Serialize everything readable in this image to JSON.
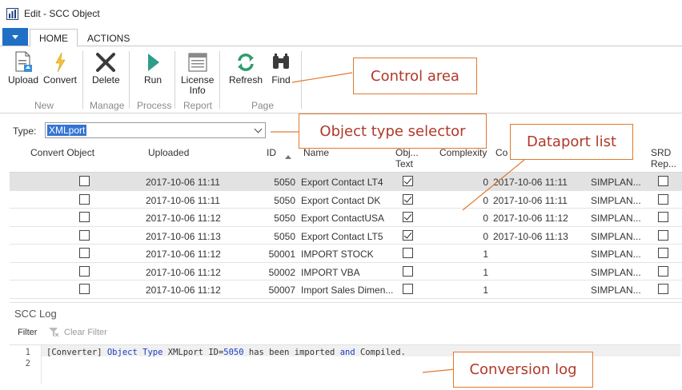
{
  "window": {
    "title": "Edit - SCC Object"
  },
  "ribbon": {
    "tabs": [
      "HOME",
      "ACTIONS"
    ],
    "buttons": {
      "upload": "Upload",
      "convert": "Convert",
      "delete": "Delete",
      "run": "Run",
      "license_info_1": "License",
      "license_info_2": "Info",
      "refresh": "Refresh",
      "find": "Find"
    },
    "groups": {
      "new": "New",
      "manage": "Manage",
      "process": "Process",
      "report": "Report",
      "page": "Page"
    }
  },
  "type_selector": {
    "label": "Type:",
    "value": "XMLport"
  },
  "grid": {
    "columns": {
      "convert_object": "Convert Object",
      "uploaded": "Uploaded",
      "id": "ID",
      "name": "Name",
      "obj_text_1": "Obj...",
      "obj_text_2": "Text",
      "complexity": "Complexity",
      "co": "Co",
      "srd_1": "SRD",
      "srd_2": "Rep..."
    },
    "rows": [
      {
        "convert": false,
        "uploaded": "2017-10-06 11:11",
        "id": "5050",
        "name": "Export Contact LT4",
        "obj_text": true,
        "complexity": "0",
        "converted": "2017-10-06 11:11",
        "user": "SIMPLAN...",
        "srd": false,
        "selected": true
      },
      {
        "convert": false,
        "uploaded": "2017-10-06 11:11",
        "id": "5050",
        "name": "Export Contact DK",
        "obj_text": true,
        "complexity": "0",
        "converted": "2017-10-06 11:11",
        "user": "SIMPLAN...",
        "srd": false,
        "selected": false
      },
      {
        "convert": false,
        "uploaded": "2017-10-06 11:12",
        "id": "5050",
        "name": "Export ContactUSA",
        "obj_text": true,
        "complexity": "0",
        "converted": "2017-10-06 11:12",
        "user": "SIMPLAN...",
        "srd": false,
        "selected": false
      },
      {
        "convert": false,
        "uploaded": "2017-10-06 11:13",
        "id": "5050",
        "name": "Export Contact LT5",
        "obj_text": true,
        "complexity": "0",
        "converted": "2017-10-06 11:13",
        "user": "SIMPLAN...",
        "srd": false,
        "selected": false
      },
      {
        "convert": false,
        "uploaded": "2017-10-06 11:12",
        "id": "50001",
        "name": "IMPORT STOCK",
        "obj_text": false,
        "complexity": "1",
        "converted": "",
        "user": "SIMPLAN...",
        "srd": false,
        "selected": false
      },
      {
        "convert": false,
        "uploaded": "2017-10-06 11:12",
        "id": "50002",
        "name": "IMPORT VBA",
        "obj_text": false,
        "complexity": "1",
        "converted": "",
        "user": "SIMPLAN...",
        "srd": false,
        "selected": false
      },
      {
        "convert": false,
        "uploaded": "2017-10-06 11:12",
        "id": "50007",
        "name": "Import Sales Dimen...",
        "obj_text": false,
        "complexity": "1",
        "converted": "",
        "user": "SIMPLAN...",
        "srd": false,
        "selected": false
      }
    ]
  },
  "log": {
    "title": "SCC Log",
    "filter": "Filter",
    "clear_filter": "Clear Filter",
    "line_numbers": [
      "1",
      "2"
    ],
    "line1": {
      "p1": "[Converter] ",
      "k1": "Object",
      "k2": "Type",
      "p2": " XMLport ID=",
      "num": "5050",
      "p3": " has been imported ",
      "k3": "and",
      "p4": " Compiled."
    }
  },
  "callouts": {
    "control_area": "Control area",
    "object_type_selector": "Object type selector",
    "dataport_list": "Dataport list",
    "conversion_log": "Conversion log"
  },
  "colors": {
    "accent": "#1f6fc5",
    "callout_border": "#e07a2e",
    "callout_text": "#b0392a",
    "selection": "#3574d4"
  }
}
